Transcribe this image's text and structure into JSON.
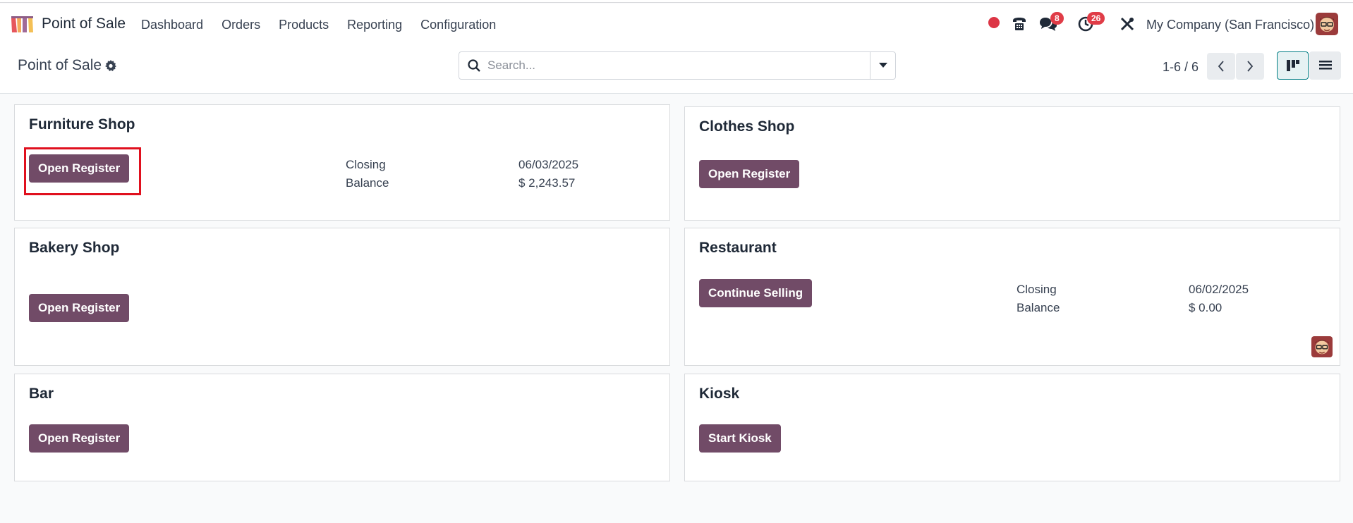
{
  "navbar": {
    "app_name": "Point of Sale",
    "menu": [
      "Dashboard",
      "Orders",
      "Products",
      "Reporting",
      "Configuration"
    ],
    "messages_badge": "8",
    "activities_badge": "26",
    "company": "My Company (San Francisco)"
  },
  "control": {
    "breadcrumb": "Point of Sale",
    "search_placeholder": "Search...",
    "pager": "1-6 / 6"
  },
  "cards": {
    "furniture": {
      "title": "Furniture Shop",
      "button": "Open Register",
      "closing_label": "Closing",
      "closing_value": "06/03/2025",
      "balance_label": "Balance",
      "balance_value": "$ 2,243.57"
    },
    "clothes": {
      "title": "Clothes Shop",
      "button": "Open Register"
    },
    "bakery": {
      "title": "Bakery Shop",
      "button": "Open Register"
    },
    "restaurant": {
      "title": "Restaurant",
      "button": "Continue Selling",
      "closing_label": "Closing",
      "closing_value": "06/02/2025",
      "balance_label": "Balance",
      "balance_value": "$ 0.00"
    },
    "bar": {
      "title": "Bar",
      "button": "Open Register"
    },
    "kiosk": {
      "title": "Kiosk",
      "button": "Start Kiosk"
    }
  },
  "colors": {
    "primary": "#714b67",
    "badge": "#e03c47",
    "highlight": "#e0101e"
  }
}
